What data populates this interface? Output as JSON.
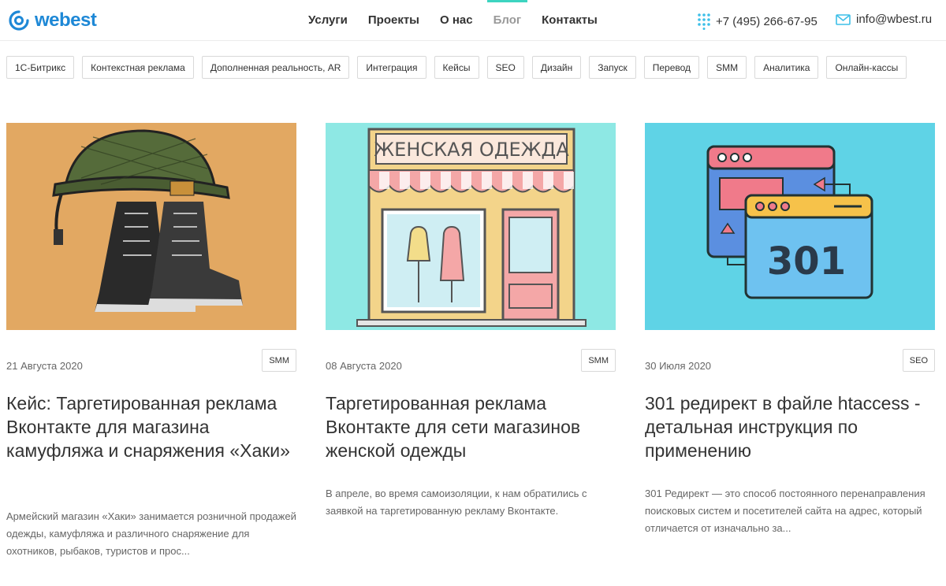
{
  "header": {
    "logo_text": "webest",
    "nav": [
      "Услуги",
      "Проекты",
      "О нас",
      "Блог",
      "Контакты"
    ],
    "active_nav": "Блог",
    "phone": "+7 (495) 266-67-95",
    "email": "info@wbest.ru"
  },
  "tags": [
    "1С-Битрикс",
    "Контекстная реклама",
    "Дополненная реальность, AR",
    "Интеграция",
    "Кейсы",
    "SEO",
    "Дизайн",
    "Запуск",
    "Перевод",
    "SMM",
    "Аналитика",
    "Онлайн-кассы"
  ],
  "cards": [
    {
      "date": "21 Августа 2020",
      "tag": "SMM",
      "title": "Кейс: Таргетированная реклама Вконтакте для магазина камуфляжа и снаряжения «Хаки»",
      "excerpt": "Армейский магазин «Хаки» занимается розничной продажей одежды, камуфляжа и различного снаряжение для охотников, рыбаков, туристов и прос..."
    },
    {
      "date": "08 Августа 2020",
      "tag": "SMM",
      "title": "Таргетированная реклама Вконтакте для сети магазинов женской одежды",
      "excerpt": "В апреле, во время самоизоляции, к нам обратились с заявкой на таргетированную рекламу Вконтакте.",
      "image_sign": "ЖЕНСКАЯ ОДЕЖДА"
    },
    {
      "date": "30 Июля 2020",
      "tag": "SEO",
      "title": "301 редирект в файле htaccess - детальная инструкция по применению",
      "excerpt": "301 Редирект — это способ постоянного перенаправления поисковых систем и посетителей сайта на адрес, который отличается от изначально за...",
      "image_code": "301"
    }
  ],
  "colors": {
    "brand": "#1e88d6",
    "accent": "#3dd4c0",
    "card1_bg": "#e2a862",
    "card2_bg": "#8ee8e4",
    "card3_bg": "#5fd3e6"
  }
}
